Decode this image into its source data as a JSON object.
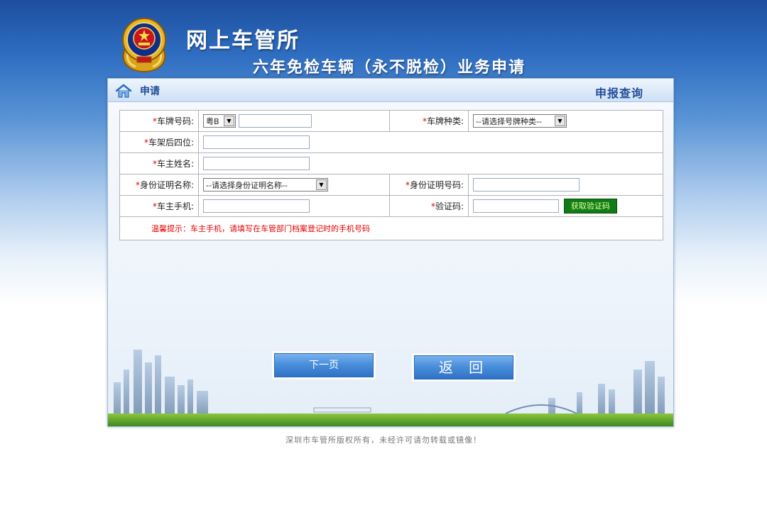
{
  "header": {
    "site_title": "网上车管所",
    "page_title": "六年免检车辆（永不脱检）业务申请"
  },
  "panel": {
    "left_label": "申请",
    "right_link": "申报查询"
  },
  "form": {
    "required_mark": "*",
    "plate_number_label": "车牌号码:",
    "plate_prefix_value": "粤B",
    "plate_number_value": "",
    "plate_type_label": "车牌种类:",
    "plate_type_value": "--请选择号牌种类--",
    "vin_last4_label": "车架后四位:",
    "vin_last4_value": "",
    "owner_name_label": "车主姓名:",
    "owner_name_value": "",
    "id_type_label": "身份证明名称:",
    "id_type_value": "--请选择身份证明名称--",
    "id_number_label": "身份证明号码:",
    "id_number_value": "",
    "phone_label": "车主手机:",
    "phone_value": "",
    "captcha_label": "验证码:",
    "captcha_value": "",
    "captcha_button": "获取验证码",
    "tip": "温馨提示：车主手机，请填写在车管部门档案登记时的手机号码"
  },
  "buttons": {
    "next": "下一页",
    "back": "返 回"
  },
  "footer": {
    "copyright": "深圳市车管所版权所有，未经许可请勿转载或镜像！"
  },
  "colors": {
    "required": "#e30000",
    "captcha_button_bg": "#0f7c17",
    "header_blue": "#1f4e96"
  }
}
